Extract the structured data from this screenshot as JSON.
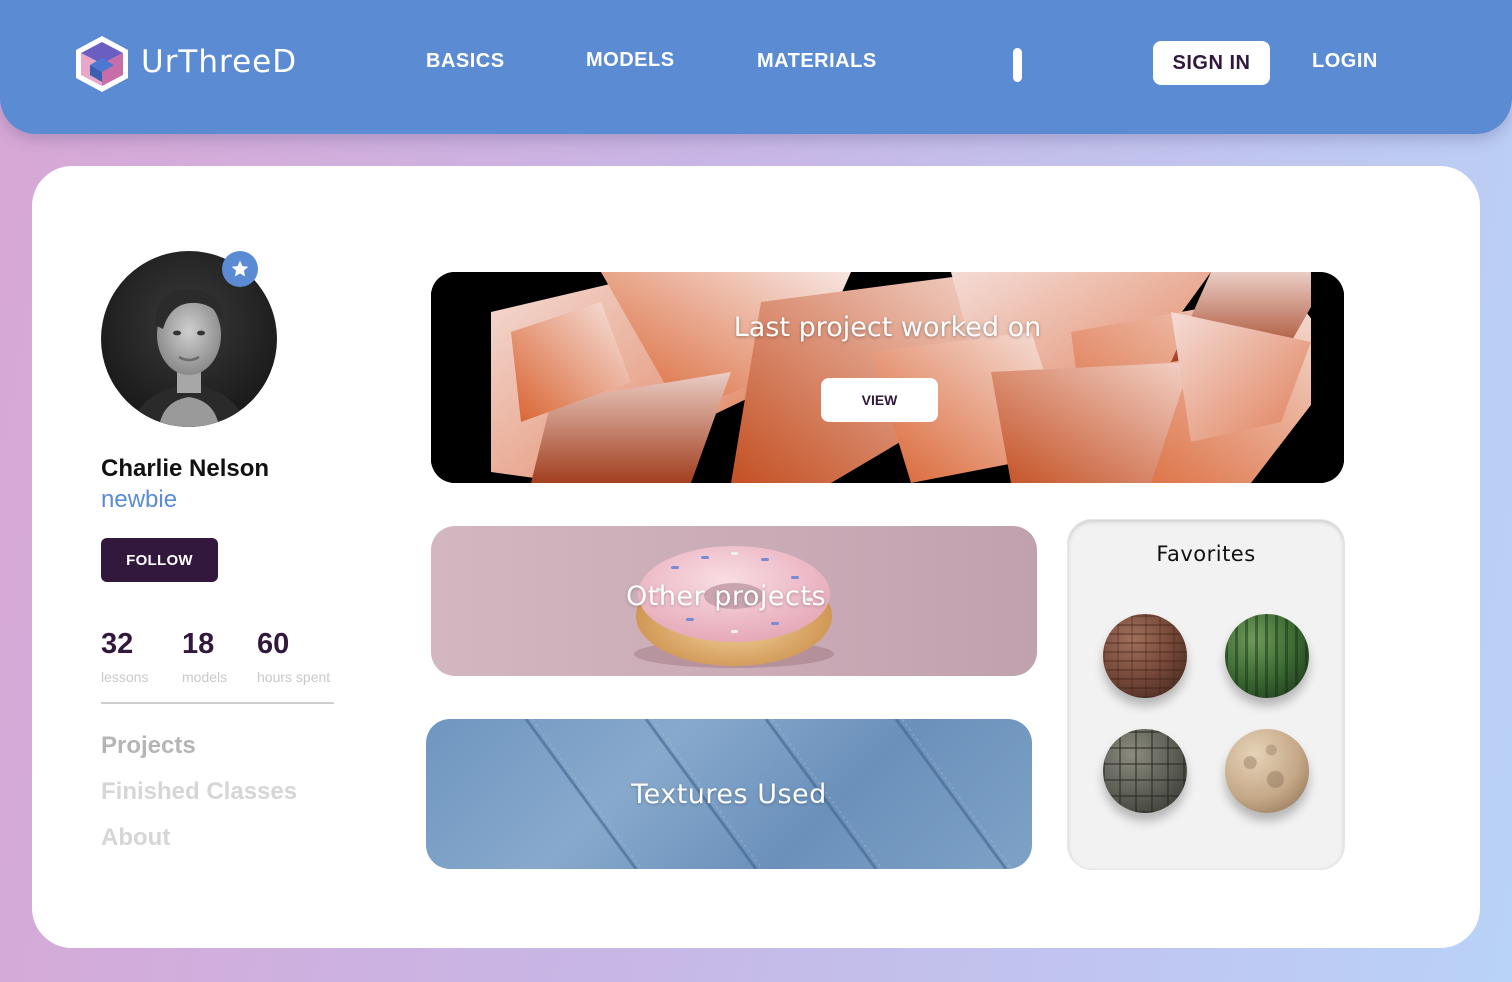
{
  "brand": {
    "name": "UrThreeD"
  },
  "nav": {
    "links": [
      "BASICS",
      "MODELS",
      "MATERIALS"
    ],
    "sign_in": "SIGN IN",
    "login": "LOGIN"
  },
  "profile": {
    "name": "Charlie Nelson",
    "rank": "newbie",
    "follow_label": "FOLLOW",
    "stats": [
      {
        "value": "32",
        "label": "lessons"
      },
      {
        "value": "18",
        "label": "models"
      },
      {
        "value": "60",
        "label": "hours spent"
      }
    ],
    "menu": [
      "Projects",
      "Finished Classes",
      "About"
    ]
  },
  "last_project": {
    "title": "Last project worked on",
    "view_label": "VIEW"
  },
  "cards": {
    "other_projects": "Other projects",
    "textures_used": "Textures Used"
  },
  "favorites": {
    "title": "Favorites",
    "items": [
      "brick-material",
      "cactus-material",
      "stone-tile-material",
      "rock-material"
    ]
  },
  "colors": {
    "nav_bg": "#5b8bd3",
    "accent_dark": "#33183d",
    "accent_blue": "#5b8bd3"
  }
}
